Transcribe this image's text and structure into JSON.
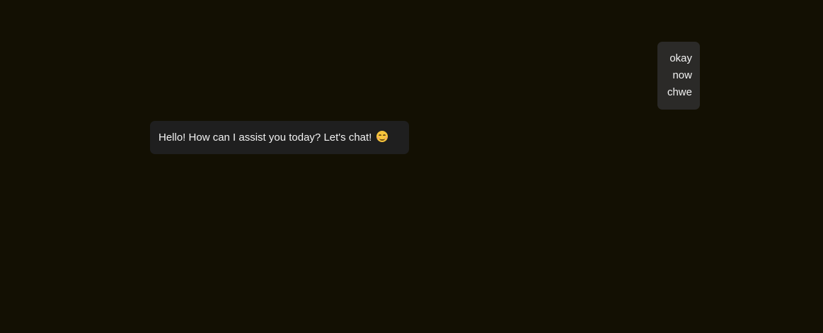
{
  "chat": {
    "messages": [
      {
        "role": "user",
        "lines": [
          "okay",
          "now",
          "chwe"
        ]
      },
      {
        "role": "assistant",
        "text": "Hello! How can I assist you today? Let's chat!",
        "emoji": "smiling-face-emoji"
      }
    ]
  },
  "colors": {
    "background": "#131003",
    "user_bubble": "#2b2a28",
    "assistant_bubble": "#1f1f1f",
    "text": "#f2f2f2"
  }
}
